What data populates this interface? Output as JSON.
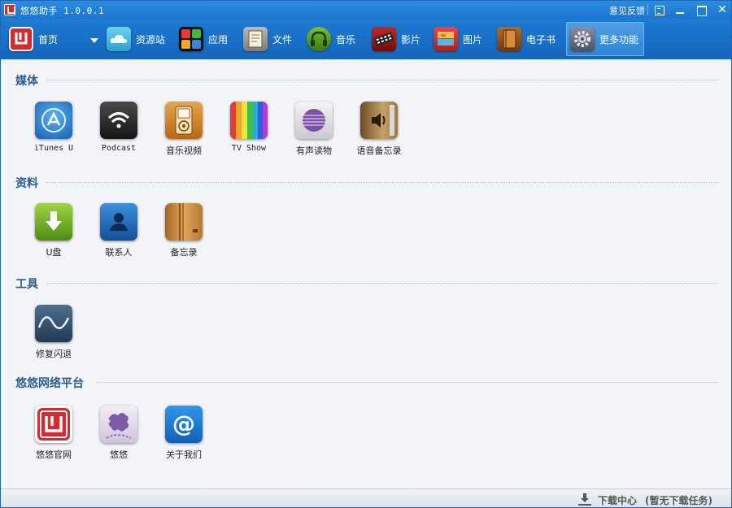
{
  "window": {
    "title": "悠悠助手 1.0.0.1",
    "feedback": "意见反馈"
  },
  "toolbar": {
    "items": [
      {
        "label": "首页",
        "icon": "home-logo-icon"
      },
      {
        "label": "资源站",
        "icon": "cloud-icon"
      },
      {
        "label": "应用",
        "icon": "apps-icon"
      },
      {
        "label": "文件",
        "icon": "file-icon"
      },
      {
        "label": "音乐",
        "icon": "headphones-icon"
      },
      {
        "label": "影片",
        "icon": "film-icon"
      },
      {
        "label": "图片",
        "icon": "picture-icon"
      },
      {
        "label": "电子书",
        "icon": "book-icon"
      },
      {
        "label": "更多功能",
        "icon": "gear-icon"
      }
    ],
    "active": "更多功能"
  },
  "sections": {
    "media": {
      "title": "媒体",
      "apps": [
        {
          "label": "iTunes U",
          "icon": "app-store-icon"
        },
        {
          "label": "Podcast",
          "icon": "wifi-signal-icon"
        },
        {
          "label": "音乐视频",
          "icon": "ipod-icon"
        },
        {
          "label": "TV Show",
          "icon": "color-bars-icon"
        },
        {
          "label": "有声读物",
          "icon": "speaker-icon"
        },
        {
          "label": "语音备忘录",
          "icon": "voice-memo-icon"
        }
      ]
    },
    "data": {
      "title": "资料",
      "apps": [
        {
          "label": "U盘",
          "icon": "download-arrow-icon"
        },
        {
          "label": "联系人",
          "icon": "contact-icon"
        },
        {
          "label": "备忘录",
          "icon": "notebook-icon"
        }
      ]
    },
    "tools": {
      "title": "工具",
      "apps": [
        {
          "label": "修复闪退",
          "icon": "wave-icon"
        }
      ]
    },
    "network": {
      "title": "悠悠网络平台",
      "apps": [
        {
          "label": "悠悠官网",
          "icon": "uu-logo-icon"
        },
        {
          "label": "悠悠",
          "icon": "puzzle-icon"
        },
        {
          "label": "关于我们",
          "icon": "at-sign-icon"
        }
      ]
    }
  },
  "statusbar": {
    "download_center": "下载中心",
    "download_status": "(暂无下载任务)"
  }
}
